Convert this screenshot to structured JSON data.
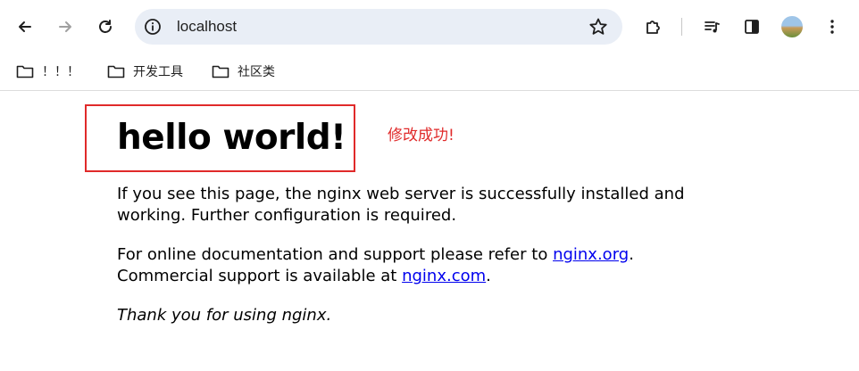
{
  "browser": {
    "url": "localhost",
    "bookmarks": [
      {
        "label": "！！！"
      },
      {
        "label": "开发工具"
      },
      {
        "label": "社区类"
      }
    ]
  },
  "page": {
    "heading": "hello world!",
    "annotation": "修改成功!",
    "para1_line1": "If you see this page, the nginx web server is successfully installed and",
    "para1_line2": "working. Further configuration is required.",
    "para2_line1_prefix": "For online documentation and support please refer to ",
    "link_org": "nginx.org",
    "para2_line1_suffix": ".",
    "para2_line2_prefix": "Commercial support is available at ",
    "link_com": "nginx.com",
    "para2_line2_suffix": ".",
    "para3": "Thank you for using nginx."
  },
  "colors": {
    "highlight_border": "#e02a2a",
    "link": "#0000ee",
    "omnibox_bg": "#e9eef6"
  }
}
